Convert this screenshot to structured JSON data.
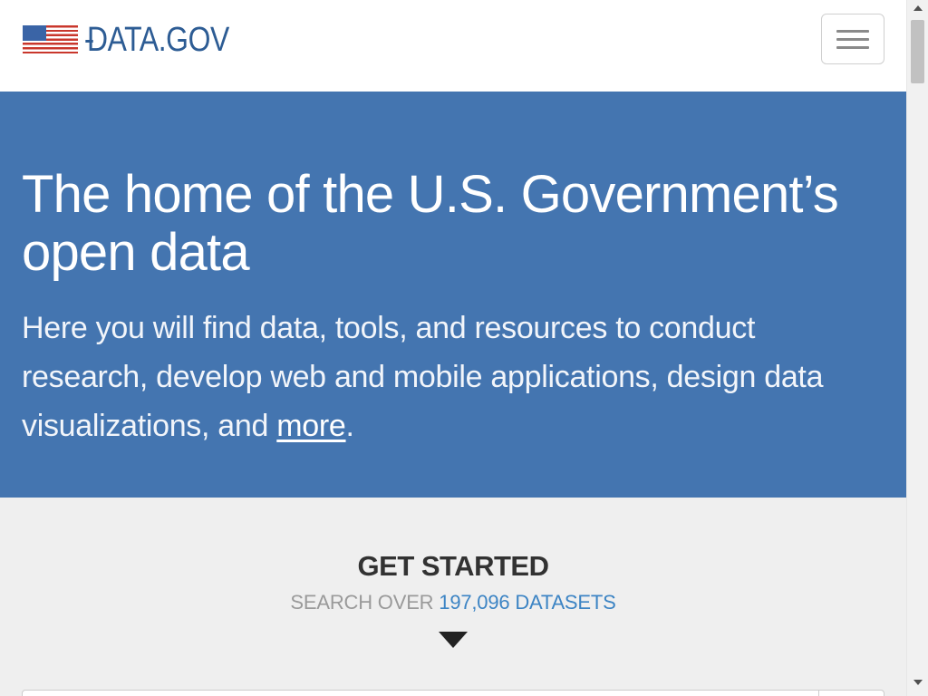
{
  "header": {
    "logo_text": "DATA.GOV",
    "menu_icon": "hamburger-menu-icon",
    "flag_icon": "us-flag-icon"
  },
  "hero": {
    "title": "The home of the U.S. Government’s open data",
    "description_prefix": "Here you will find data, tools, and resources to conduct research, develop web and mobile applications, design data visualizations, and ",
    "description_link": "more",
    "description_suffix": "."
  },
  "get_started": {
    "title": "GET STARTED",
    "subtitle_prefix": "SEARCH OVER",
    "dataset_count": "197,096 DATASETS",
    "arrow_icon": "caret-down-icon"
  },
  "colors": {
    "hero_bg": "#4475b0",
    "logo_blue": "#2d5c94",
    "link_blue": "#3c84c4",
    "section_bg": "#efefef"
  }
}
